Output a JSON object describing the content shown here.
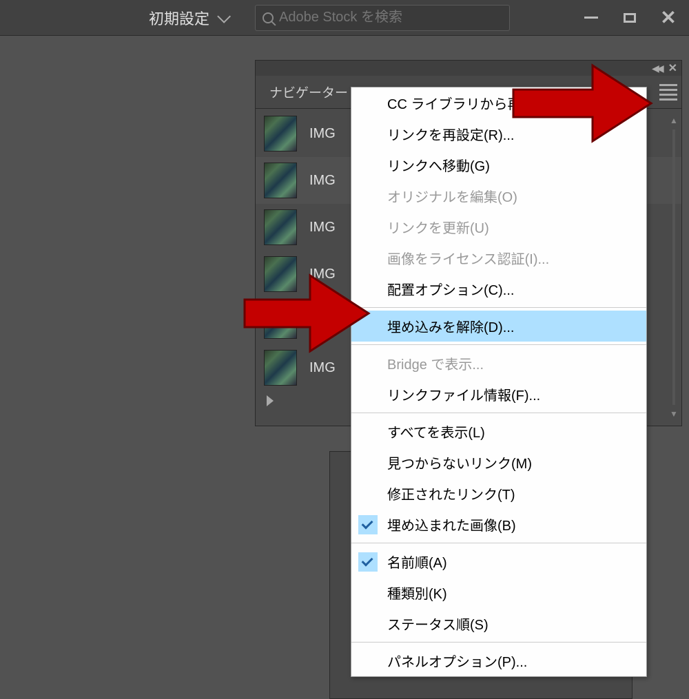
{
  "topbar": {
    "workspace_label": "初期設定",
    "search_placeholder": "Adobe Stock を検索"
  },
  "panel": {
    "tab_label": "ナビゲーター",
    "links": [
      {
        "name": "IMG"
      },
      {
        "name": "IMG"
      },
      {
        "name": "IMG"
      },
      {
        "name": "IMG"
      },
      {
        "name": "IMG"
      },
      {
        "name": "IMG"
      }
    ],
    "selected_index": 1
  },
  "context_menu": {
    "items": [
      {
        "label": "CC ライブラリから再リ",
        "disabled": false
      },
      {
        "label": "リンクを再設定(R)...",
        "disabled": false
      },
      {
        "label": "リンクへ移動(G)",
        "disabled": false
      },
      {
        "label": "オリジナルを編集(O)",
        "disabled": true
      },
      {
        "label": "リンクを更新(U)",
        "disabled": true
      },
      {
        "label": "画像をライセンス認証(I)...",
        "disabled": true
      },
      {
        "label": "配置オプション(C)...",
        "disabled": false
      },
      {
        "sep": true
      },
      {
        "label": "埋め込みを解除(D)...",
        "disabled": false,
        "highlighted": true
      },
      {
        "sep": true
      },
      {
        "label": "Bridge で表示...",
        "disabled": true
      },
      {
        "label": "リンクファイル情報(F)...",
        "disabled": false
      },
      {
        "sep": true
      },
      {
        "label": "すべてを表示(L)",
        "disabled": false
      },
      {
        "label": "見つからないリンク(M)",
        "disabled": false
      },
      {
        "label": "修正されたリンク(T)",
        "disabled": false
      },
      {
        "label": "埋め込まれた画像(B)",
        "disabled": false,
        "checked": true
      },
      {
        "sep": true
      },
      {
        "label": "名前順(A)",
        "disabled": false,
        "checked": true
      },
      {
        "label": "種類別(K)",
        "disabled": false
      },
      {
        "label": "ステータス順(S)",
        "disabled": false
      },
      {
        "sep": true
      },
      {
        "label": "パネルオプション(P)...",
        "disabled": false
      }
    ]
  }
}
